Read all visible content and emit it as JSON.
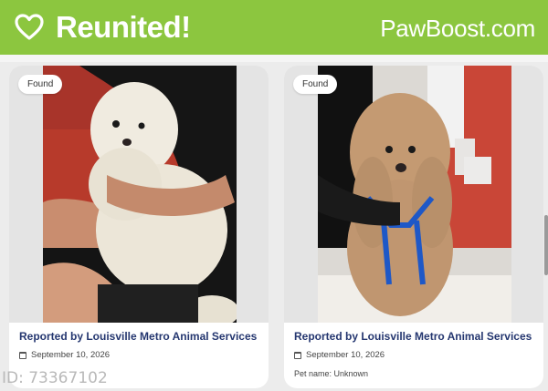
{
  "banner": {
    "title": "Reunited!",
    "brand": "PawBoost.com",
    "color": "#8cc63f",
    "icon": "heart-icon"
  },
  "cards": [
    {
      "badge": "Found",
      "reporter": "Reported by Louisville Metro Animal Services",
      "date": "September 10, 2026",
      "date_icon": "calendar-icon"
    },
    {
      "badge": "Found",
      "reporter": "Reported by Louisville Metro Animal Services",
      "date": "September 10, 2026",
      "date_icon": "calendar-icon",
      "pet_name": "Pet name: Unknown"
    }
  ],
  "footer": {
    "id_text": "ID: 73367102"
  },
  "colors": {
    "link_text": "#253770",
    "page_bg": "#ececec"
  }
}
